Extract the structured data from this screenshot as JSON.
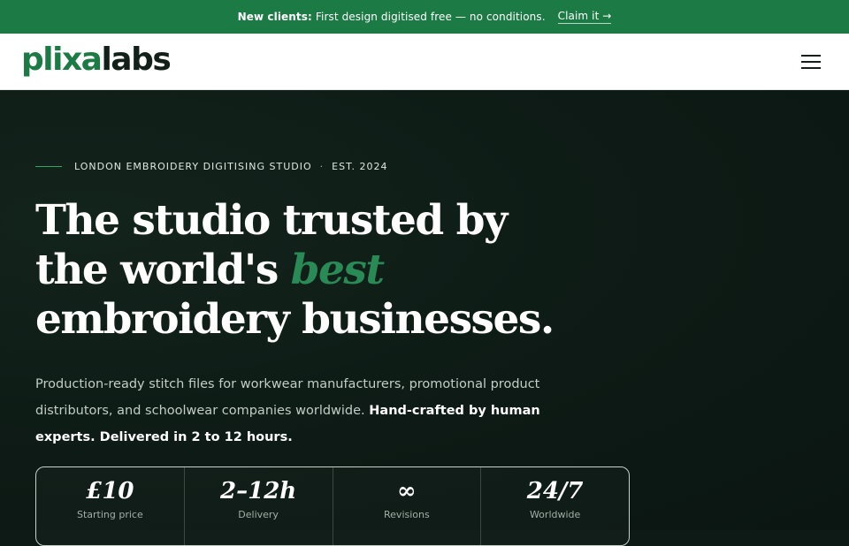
{
  "colors": {
    "brand_green": "#1c7a45",
    "accent_green": "#2a8a55",
    "hero_bg": "#0d1a15",
    "header_bg": "#ffffff"
  },
  "announcement": {
    "lead": "New clients:",
    "text": "First design digitised free — no conditions.",
    "cta": "Claim it →"
  },
  "header": {
    "logo_prefix": "plixa",
    "logo_suffix": "labs",
    "menu_icon": "hamburger-menu-icon"
  },
  "hero": {
    "eyebrow_left": "LONDON EMBROIDERY DIGITISING STUDIO",
    "eyebrow_sep": "·",
    "eyebrow_right": "EST. 2024",
    "headline_line1": "The studio trusted by",
    "headline_line2_pre": "the world's ",
    "headline_accent": "best",
    "headline_line3": "embroidery businesses.",
    "lede_text": "Production-ready stitch files for workwear manufacturers, promotional product distributors, and schoolwear companies worldwide. ",
    "lede_strong": "Hand-crafted by human experts. Delivered in 2 to 12 hours."
  },
  "stats": [
    {
      "value": "£10",
      "label": "Starting price"
    },
    {
      "value": "2–12h",
      "label": "Delivery"
    },
    {
      "value": "∞",
      "label": "Revisions"
    },
    {
      "value": "24/7",
      "label": "Worldwide"
    }
  ]
}
